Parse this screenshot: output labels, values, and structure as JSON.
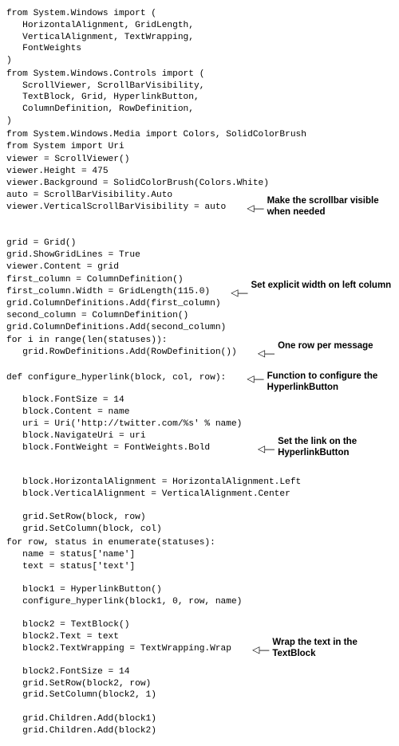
{
  "code": {
    "imports1": "from System.Windows import (\n   HorizontalAlignment, GridLength,\n   VerticalAlignment, TextWrapping,\n   FontWeights\n)\n",
    "imports2": "from System.Windows.Controls import (\n   ScrollViewer, ScrollBarVisibility,\n   TextBlock, Grid, HyperlinkButton,\n   ColumnDefinition, RowDefinition,\n)\n",
    "imports3": "from System.Windows.Media import Colors, SolidColorBrush\nfrom System import Uri\n",
    "viewer1": "viewer = ScrollViewer()\nviewer.Height = 475\nviewer.Background = SolidColorBrush(Colors.White)",
    "viewer2a": "auto = ScrollBarVisibility.Auto",
    "viewer2b": "viewer.VerticalScrollBarVisibility = auto   ",
    "grid1": "grid = Grid()\ngrid.ShowGridLines = True\nviewer.Content = grid\n",
    "cols1": "first_column = ColumnDefinition()",
    "cols2": "first_column.Width = GridLength(115.0)   ",
    "cols3": "grid.ColumnDefinitions.Add(first_column)\nsecond_column = ColumnDefinition()\ngrid.ColumnDefinitions.Add(second_column)\n",
    "rows1": "for i in range(len(statuses)):",
    "rows2": "   grid.RowDefinitions.Add(RowDefinition())   ",
    "fn1": "def configure_hyperlink(block, col, row):   ",
    "fn2": "   block.FontSize = 14",
    "fn3": "   block.Content = name\n   uri = Uri('http://twitter.com/%s' % name)",
    "fn4a": "   block.NavigateUri = uri",
    "fn4b": "   block.FontWeight = FontWeights.Bold        ",
    "fn5": "   block.HorizontalAlignment = HorizontalAlignment.Left\n   block.VerticalAlignment = VerticalAlignment.Center",
    "fn6": "   grid.SetRow(block, row)\n   grid.SetColumn(block, col)\n",
    "loop1": "for row, status in enumerate(statuses):\n   name = status['name']\n   text = status['text']",
    "loop2": "   block1 = HyperlinkButton()\n   configure_hyperlink(block1, 0, row, name)",
    "loop3": "   block2 = TextBlock()\n   block2.Text = text",
    "loop4": "   block2.TextWrapping = TextWrapping.Wrap   ",
    "loop5": "   block2.FontSize = 14\n   grid.SetRow(block2, row)\n   grid.SetColumn(block2, 1)",
    "loop6": "   grid.Children.Add(block1)\n   grid.Children.Add(block2)"
  },
  "annotations": {
    "scrollbar": "Make the scrollbar visible when needed",
    "width": "Set explicit width on left column",
    "rows": "One row per message",
    "func": "Function to configure the HyperlinkButton",
    "link": "Set the link on the HyperlinkButton",
    "wrap": "Wrap the text in the TextBlock"
  },
  "glyphs": {
    "left_arrow": "◁—"
  }
}
